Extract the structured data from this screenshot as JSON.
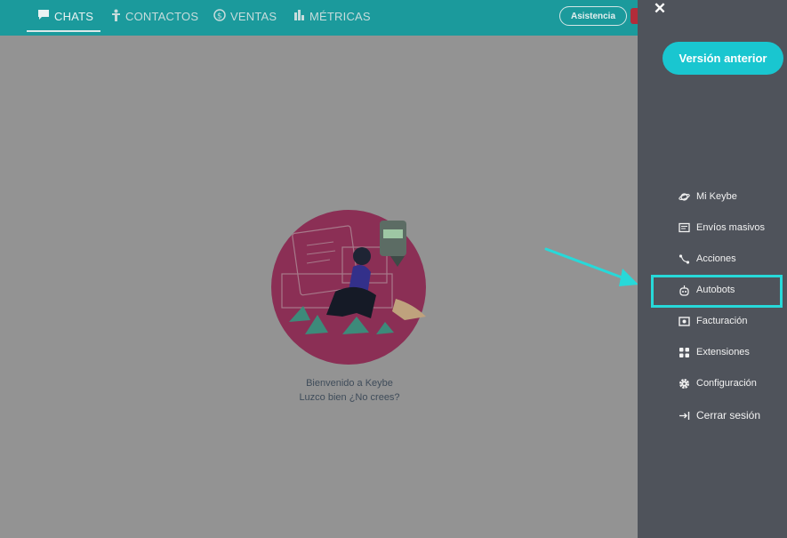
{
  "nav": {
    "tabs": [
      {
        "label": "CHATS",
        "icon": "chat-bubble-icon",
        "active": true
      },
      {
        "label": "CONTACTOS",
        "icon": "person-icon"
      },
      {
        "label": "VENTAS",
        "icon": "dollar-coin-icon"
      },
      {
        "label": "MÉTRICAS",
        "icon": "bar-chart-icon"
      }
    ],
    "assist_label": "Asistencia"
  },
  "main": {
    "welcome_line1": "Bienvenido a Keybe",
    "welcome_line2": "Luzco bien ¿No crees?"
  },
  "sidepanel": {
    "close_label": "✕",
    "prev_version_label": "Versión anterior",
    "items": [
      {
        "label": "Mi Keybe",
        "icon": "planet-icon"
      },
      {
        "label": "Envíos masivos",
        "icon": "message-square-icon"
      },
      {
        "label": "Acciones",
        "icon": "route-icon"
      },
      {
        "label": "Autobots",
        "icon": "robot-icon"
      },
      {
        "label": "Facturación",
        "icon": "billing-icon"
      },
      {
        "label": "Extensiones",
        "icon": "grid-icon"
      },
      {
        "label": "Configuración",
        "icon": "gear-icon"
      },
      {
        "label": "Cerrar sesión",
        "icon": "logout-icon"
      }
    ],
    "highlighted_item": "Autobots"
  },
  "colors": {
    "topbar": "#1b9a9c",
    "overlay": "#939393",
    "panel": "#4f535b",
    "accent": "#19c6d0",
    "highlight": "#27d9d9",
    "hero_circle": "#8b2f55"
  }
}
